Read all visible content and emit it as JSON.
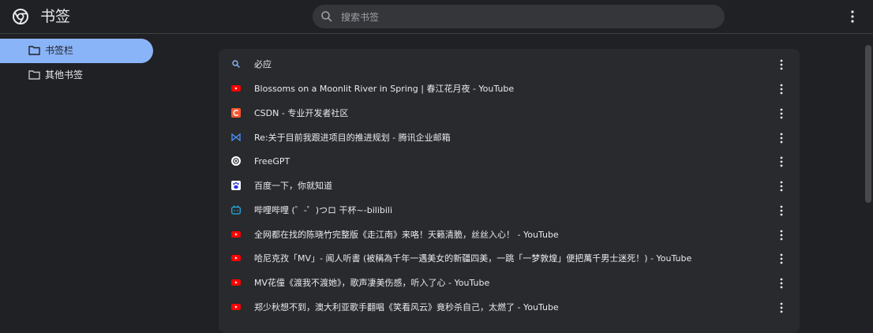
{
  "header": {
    "title": "书签",
    "search_placeholder": "搜索书签",
    "logo_icon": "chrome-logo-icon",
    "menu_icon": "more-vert-icon"
  },
  "sidebar": {
    "items": [
      {
        "label": "书签栏",
        "icon": "folder-icon",
        "active": true
      },
      {
        "label": "其他书签",
        "icon": "folder-icon",
        "active": false
      }
    ]
  },
  "bookmarks": [
    {
      "label": "必应",
      "icon": "bing-search-icon"
    },
    {
      "label": "Blossoms on a Moonlit River in Spring | 春江花月夜 - YouTube",
      "icon": "youtube-icon"
    },
    {
      "label": "CSDN - 专业开发者社区",
      "icon": "csdn-icon"
    },
    {
      "label": "Re:关于目前我跟进项目的推进规划 - 腾讯企业邮箱",
      "icon": "tencent-mail-icon"
    },
    {
      "label": "FreeGPT",
      "icon": "openai-icon"
    },
    {
      "label": "百度一下，你就知道",
      "icon": "baidu-icon"
    },
    {
      "label": "哔哩哔哩 (゜-゜)つロ 干杯~-bilibili",
      "icon": "bilibili-icon"
    },
    {
      "label": "全网都在找的陈晓竹完整版《走江南》来咯！天籁清脆，丝丝入心！ - YouTube",
      "icon": "youtube-icon"
    },
    {
      "label": "哈尼克孜「MV」- 闻人听書 (被稱為千年一遇美女的新疆四美，一跳「一梦敦煌」便把萬千男士迷死！) - YouTube",
      "icon": "youtube-icon"
    },
    {
      "label": "MV花僮《渡我不渡她》，歌声凄美伤感，听入了心 - YouTube",
      "icon": "youtube-icon"
    },
    {
      "label": "郑少秋想不到，澳大利亚歌手翻唱《笑看风云》竟秒杀自己，太燃了 - YouTube",
      "icon": "youtube-icon"
    }
  ],
  "colors": {
    "background": "#202124",
    "card": "#292a2d",
    "active_accent": "#8ab4f8",
    "youtube_red": "#ff0000",
    "csdn_orange": "#fc5531"
  }
}
